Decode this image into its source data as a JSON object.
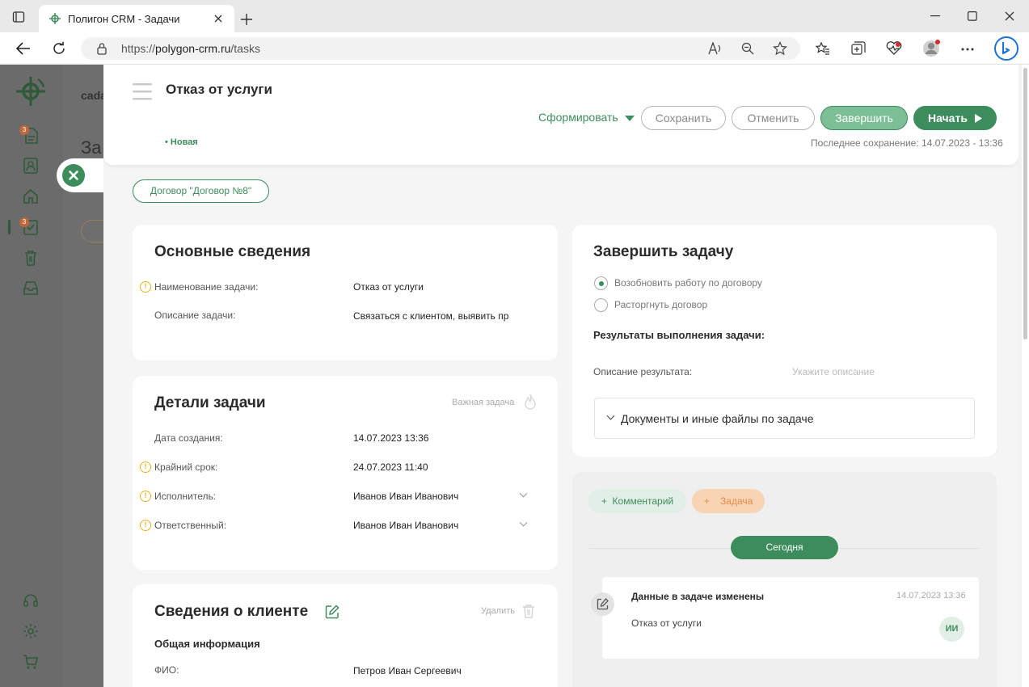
{
  "browser": {
    "tab_title": "Полигон CRM - Задачи",
    "url_prefix": "https://",
    "url_host": "polygon-crm.ru",
    "url_path": "/tasks"
  },
  "behind_page": {
    "text1": "cada",
    "text2": "За"
  },
  "sidebar": {
    "badge_docs": "3",
    "badge_tasks": "3"
  },
  "header": {
    "title": "Отказ от услуги",
    "status": "• Новая",
    "form_label": "Сформировать",
    "save_label": "Сохранить",
    "cancel_label": "Отменить",
    "finish_label": "Завершить",
    "start_label": "Начать",
    "last_saved": "Последнее сохранение: 14.07.2023 - 13:36"
  },
  "contract_chip": "Договор \"Договор №8\"",
  "basic": {
    "title": "Основные сведения",
    "rows": [
      {
        "label": "Наименование задачи:",
        "value": "Отказ от услуги"
      },
      {
        "label": "Описание задачи:",
        "value": "Связаться с клиентом, выявить причину отказа"
      }
    ]
  },
  "details": {
    "title": "Детали задачи",
    "important_label": "Важная задача",
    "rows": [
      {
        "label": "Дата создания:",
        "value": "14.07.2023 13:36"
      },
      {
        "label": "Крайний срок:",
        "value": "24.07.2023 11:40"
      },
      {
        "label": "Исполнитель:",
        "value": "Иванов Иван Иванович"
      },
      {
        "label": "Ответственный:",
        "value": "Иванов Иван Иванович"
      }
    ]
  },
  "client": {
    "title": "Сведения о клиенте",
    "delete_label": "Удалить",
    "section": "Общая информация",
    "fio_label": "ФИО:",
    "fio_value": "Петров Иван Сергеевич"
  },
  "complete": {
    "title": "Завершить задачу",
    "option1": "Возобновить работу по договору",
    "option2": "Расторгнуть договор",
    "selected": 1,
    "results_title": "Результаты выполнения задачи:",
    "desc_label": "Описание результата:",
    "desc_placeholder": "Укажите описание",
    "docs_label": "Документы и иные файлы по задаче"
  },
  "activity": {
    "comment_label": "+  Комментарий",
    "task_label": "+    Задача",
    "today_label": "Сегодня",
    "event_title": "Данные в задаче изменены",
    "event_time": "14.07.2023 13:36",
    "event_text": "Отказ от услуги",
    "avatar": "ИИ"
  },
  "colors": {
    "accent": "#3d8c5c",
    "accent_light": "#7cbf96",
    "warning": "#e8b21c",
    "task_orange": "#f0a36b"
  }
}
